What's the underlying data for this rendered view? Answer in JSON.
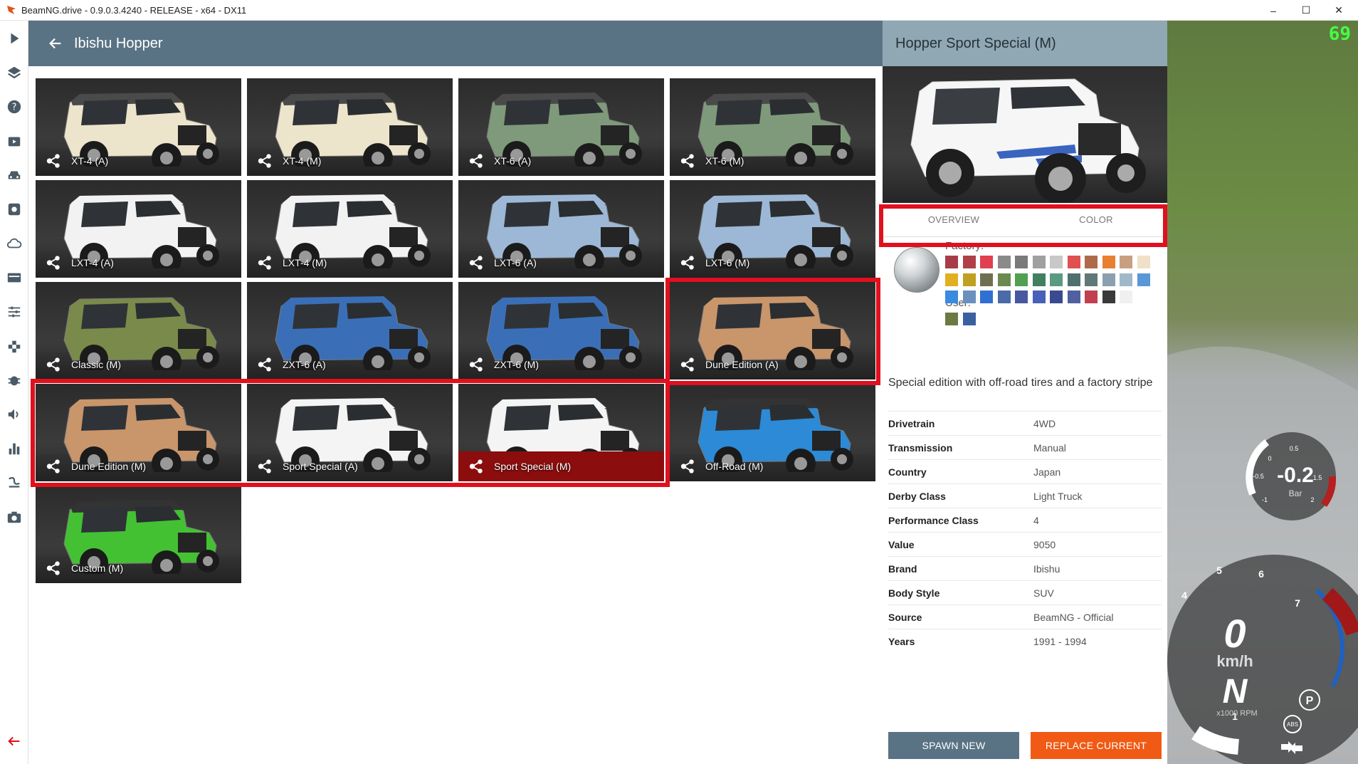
{
  "window": {
    "title": "BeamNG.drive - 0.9.0.3.4240 - RELEASE - x64 - DX11",
    "controls": {
      "minimize": "–",
      "maximize": "☐",
      "close": "✕"
    }
  },
  "sidebar": {
    "icons": [
      "play-icon",
      "layers-icon",
      "help-icon",
      "scenario-icon",
      "car-icon",
      "settings-icon",
      "cloud-icon",
      "dashboard-icon",
      "tune-icon",
      "parts-icon",
      "bug-icon",
      "audio-icon",
      "stats-icon",
      "track-icon",
      "camera-icon"
    ],
    "exit_icon": "exit-arrow-icon"
  },
  "header": {
    "title": "Ibishu Hopper",
    "back_icon": "back-arrow-icon"
  },
  "configs": [
    {
      "label": "XT-4 (A)",
      "body": "#ede4cc",
      "top": "#4a4a4a"
    },
    {
      "label": "XT-4 (M)",
      "body": "#ede4cc",
      "top": "#4a4a4a"
    },
    {
      "label": "XT-6 (A)",
      "body": "#7f9a7a",
      "top": "#4a4a4a"
    },
    {
      "label": "XT-6 (M)",
      "body": "#7f9a7a",
      "top": "#4a4a4a"
    },
    {
      "label": "LXT-4 (A)",
      "body": "#f2f2f2",
      "top": "#f2f2f2"
    },
    {
      "label": "LXT-4 (M)",
      "body": "#f2f2f2",
      "top": "#f2f2f2"
    },
    {
      "label": "LXT-6 (A)",
      "body": "#9db8d6",
      "top": "#9db8d6"
    },
    {
      "label": "LXT-6 (M)",
      "body": "#9db8d6",
      "top": "#9db8d6"
    },
    {
      "label": "Classic (M)",
      "body": "#7a8a4a",
      "top": "none"
    },
    {
      "label": "ZXT-6 (A)",
      "body": "#3a6fb8",
      "top": "#3a6fb8"
    },
    {
      "label": "ZXT-6 (M)",
      "body": "#3a6fb8",
      "top": "#3a6fb8"
    },
    {
      "label": "Dune Edition (A)",
      "body": "#c9956b",
      "top": "#c9956b"
    },
    {
      "label": "Dune Edition (M)",
      "body": "#c9956b",
      "top": "#c9956b"
    },
    {
      "label": "Sport Special (A)",
      "body": "#f4f4f4",
      "top": "#f4f4f4"
    },
    {
      "label": "Sport Special (M)",
      "body": "#f4f4f4",
      "top": "#f4f4f4",
      "selected": true
    },
    {
      "label": "Off-Road (M)",
      "body": "#2c8ad6",
      "top": "#333333"
    },
    {
      "label": "Custom (M)",
      "body": "#43c133",
      "top": "#333333"
    }
  ],
  "detail": {
    "title": "Hopper Sport Special (M)",
    "tabs": [
      "OVERVIEW",
      "COLOR"
    ],
    "factory_label": "Factory:",
    "user_label": "User:",
    "factory_colors": [
      "#a83c46",
      "#b04048",
      "#e04050",
      "#8a8a8a",
      "#7a7a7a",
      "#a0a0a0",
      "#c8c8c8",
      "#e05050",
      "#b06a4a",
      "#e88030",
      "#c8a080",
      "#f0e0c8",
      "#e0b020",
      "#c0a020",
      "#707050",
      "#6a8a50",
      "#50a050",
      "#408060",
      "#5a9a80",
      "#507070",
      "#607878",
      "#8aa0b0",
      "#a0b8c8",
      "#5898d8",
      "#3a8ae0",
      "#6a90c0",
      "#3070d0",
      "#4a6aa8",
      "#4858a0",
      "#4860b8",
      "#3a4a90",
      "#5060a0",
      "#c04050",
      "#3a3a3a",
      "#f0f0f0"
    ],
    "user_colors": [
      "#6a7a40",
      "#3a60a0"
    ],
    "description": "Special edition with off-road tires and a factory stripe",
    "specs": [
      {
        "key": "Drivetrain",
        "value": "4WD"
      },
      {
        "key": "Transmission",
        "value": "Manual"
      },
      {
        "key": "Country",
        "value": "Japan"
      },
      {
        "key": "Derby Class",
        "value": "Light Truck"
      },
      {
        "key": "Performance Class",
        "value": "4"
      },
      {
        "key": "Value",
        "value": "9050"
      },
      {
        "key": "Brand",
        "value": "Ibishu"
      },
      {
        "key": "Body Style",
        "value": "SUV"
      },
      {
        "key": "Source",
        "value": "BeamNG - Official"
      },
      {
        "key": "Years",
        "value": "1991 - 1994"
      }
    ],
    "spawn_new": "SPAWN NEW",
    "replace_current": "REPLACE CURRENT",
    "spawn_color": "#5a7384",
    "replace_color": "#f05a14"
  },
  "hud": {
    "fps": "69",
    "boost": "-0.2",
    "boost_unit": "Bar",
    "boost_ticks": [
      "-1",
      "-0.5",
      "0",
      "0.5",
      "1.5",
      "2"
    ],
    "speed": "0",
    "speed_unit": "km/h",
    "gear": "N",
    "rpm_unit": "x1000 RPM",
    "rpm_ticks": [
      "1",
      "4",
      "5",
      "6",
      "7"
    ],
    "park": "P",
    "abs": "ABS"
  }
}
